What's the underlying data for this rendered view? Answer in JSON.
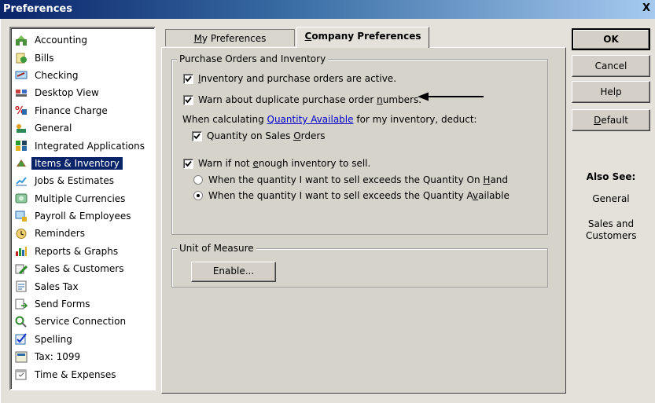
{
  "window": {
    "title": "Preferences",
    "close_label": "X"
  },
  "sidebar": {
    "items": [
      {
        "label": "Accounting",
        "icon": "accounting-icon"
      },
      {
        "label": "Bills",
        "icon": "bills-icon"
      },
      {
        "label": "Checking",
        "icon": "checking-icon"
      },
      {
        "label": "Desktop View",
        "icon": "desktop-view-icon"
      },
      {
        "label": "Finance Charge",
        "icon": "finance-charge-icon"
      },
      {
        "label": "General",
        "icon": "general-icon"
      },
      {
        "label": "Integrated Applications",
        "icon": "integrated-applications-icon"
      },
      {
        "label": "Items & Inventory",
        "icon": "items-inventory-icon",
        "selected": true
      },
      {
        "label": "Jobs & Estimates",
        "icon": "jobs-estimates-icon"
      },
      {
        "label": "Multiple Currencies",
        "icon": "multiple-currencies-icon"
      },
      {
        "label": "Payroll & Employees",
        "icon": "payroll-employees-icon"
      },
      {
        "label": "Reminders",
        "icon": "reminders-icon"
      },
      {
        "label": "Reports & Graphs",
        "icon": "reports-graphs-icon"
      },
      {
        "label": "Sales & Customers",
        "icon": "sales-customers-icon"
      },
      {
        "label": "Sales Tax",
        "icon": "sales-tax-icon"
      },
      {
        "label": "Send Forms",
        "icon": "send-forms-icon"
      },
      {
        "label": "Service Connection",
        "icon": "service-connection-icon"
      },
      {
        "label": "Spelling",
        "icon": "spelling-icon"
      },
      {
        "label": "Tax: 1099",
        "icon": "tax-1099-icon"
      },
      {
        "label": "Time & Expenses",
        "icon": "time-expenses-icon"
      }
    ]
  },
  "tabs": {
    "my_preferences": {
      "pre": "",
      "mnemonic": "M",
      "post": "y Preferences"
    },
    "company_preferences": {
      "pre": "",
      "mnemonic": "C",
      "post": "ompany Preferences"
    }
  },
  "purchase_orders": {
    "legend": "Purchase Orders and Inventory",
    "active": {
      "checked": true,
      "pre": "",
      "mnemonic": "I",
      "post": "nventory and purchase orders are active."
    },
    "warn_duplicate": {
      "checked": true,
      "pre": "Warn about duplicate purchase order ",
      "mnemonic": "n",
      "post": "umbers."
    },
    "calc_pre": "When calculating ",
    "calc_link": "Quantity Available",
    "calc_post": " for my inventory, deduct:",
    "qty_sales_orders": {
      "checked": true,
      "pre": "Quantity on Sales ",
      "mnemonic": "O",
      "post": "rders"
    },
    "warn_not_enough": {
      "checked": true,
      "pre": "Warn if not ",
      "mnemonic": "e",
      "post": "nough inventory to sell."
    },
    "radio_on_hand": {
      "selected": false,
      "pre": "When the quantity I want to sell exceeds the Quantity On ",
      "mnemonic": "H",
      "post": "and"
    },
    "radio_available": {
      "selected": true,
      "pre": "When the quantity I want to sell exceeds the Quantity A",
      "mnemonic": "v",
      "post": "ailable"
    }
  },
  "unit_of_measure": {
    "legend": "Unit of Measure",
    "enable_label": "Enable..."
  },
  "buttons": {
    "ok": "OK",
    "cancel": "Cancel",
    "help": "Help",
    "default": {
      "pre": "",
      "mnemonic": "D",
      "post": "efault"
    }
  },
  "also_see": {
    "title": "Also See:",
    "general": "General",
    "sales_customers": "Sales and Customers"
  }
}
